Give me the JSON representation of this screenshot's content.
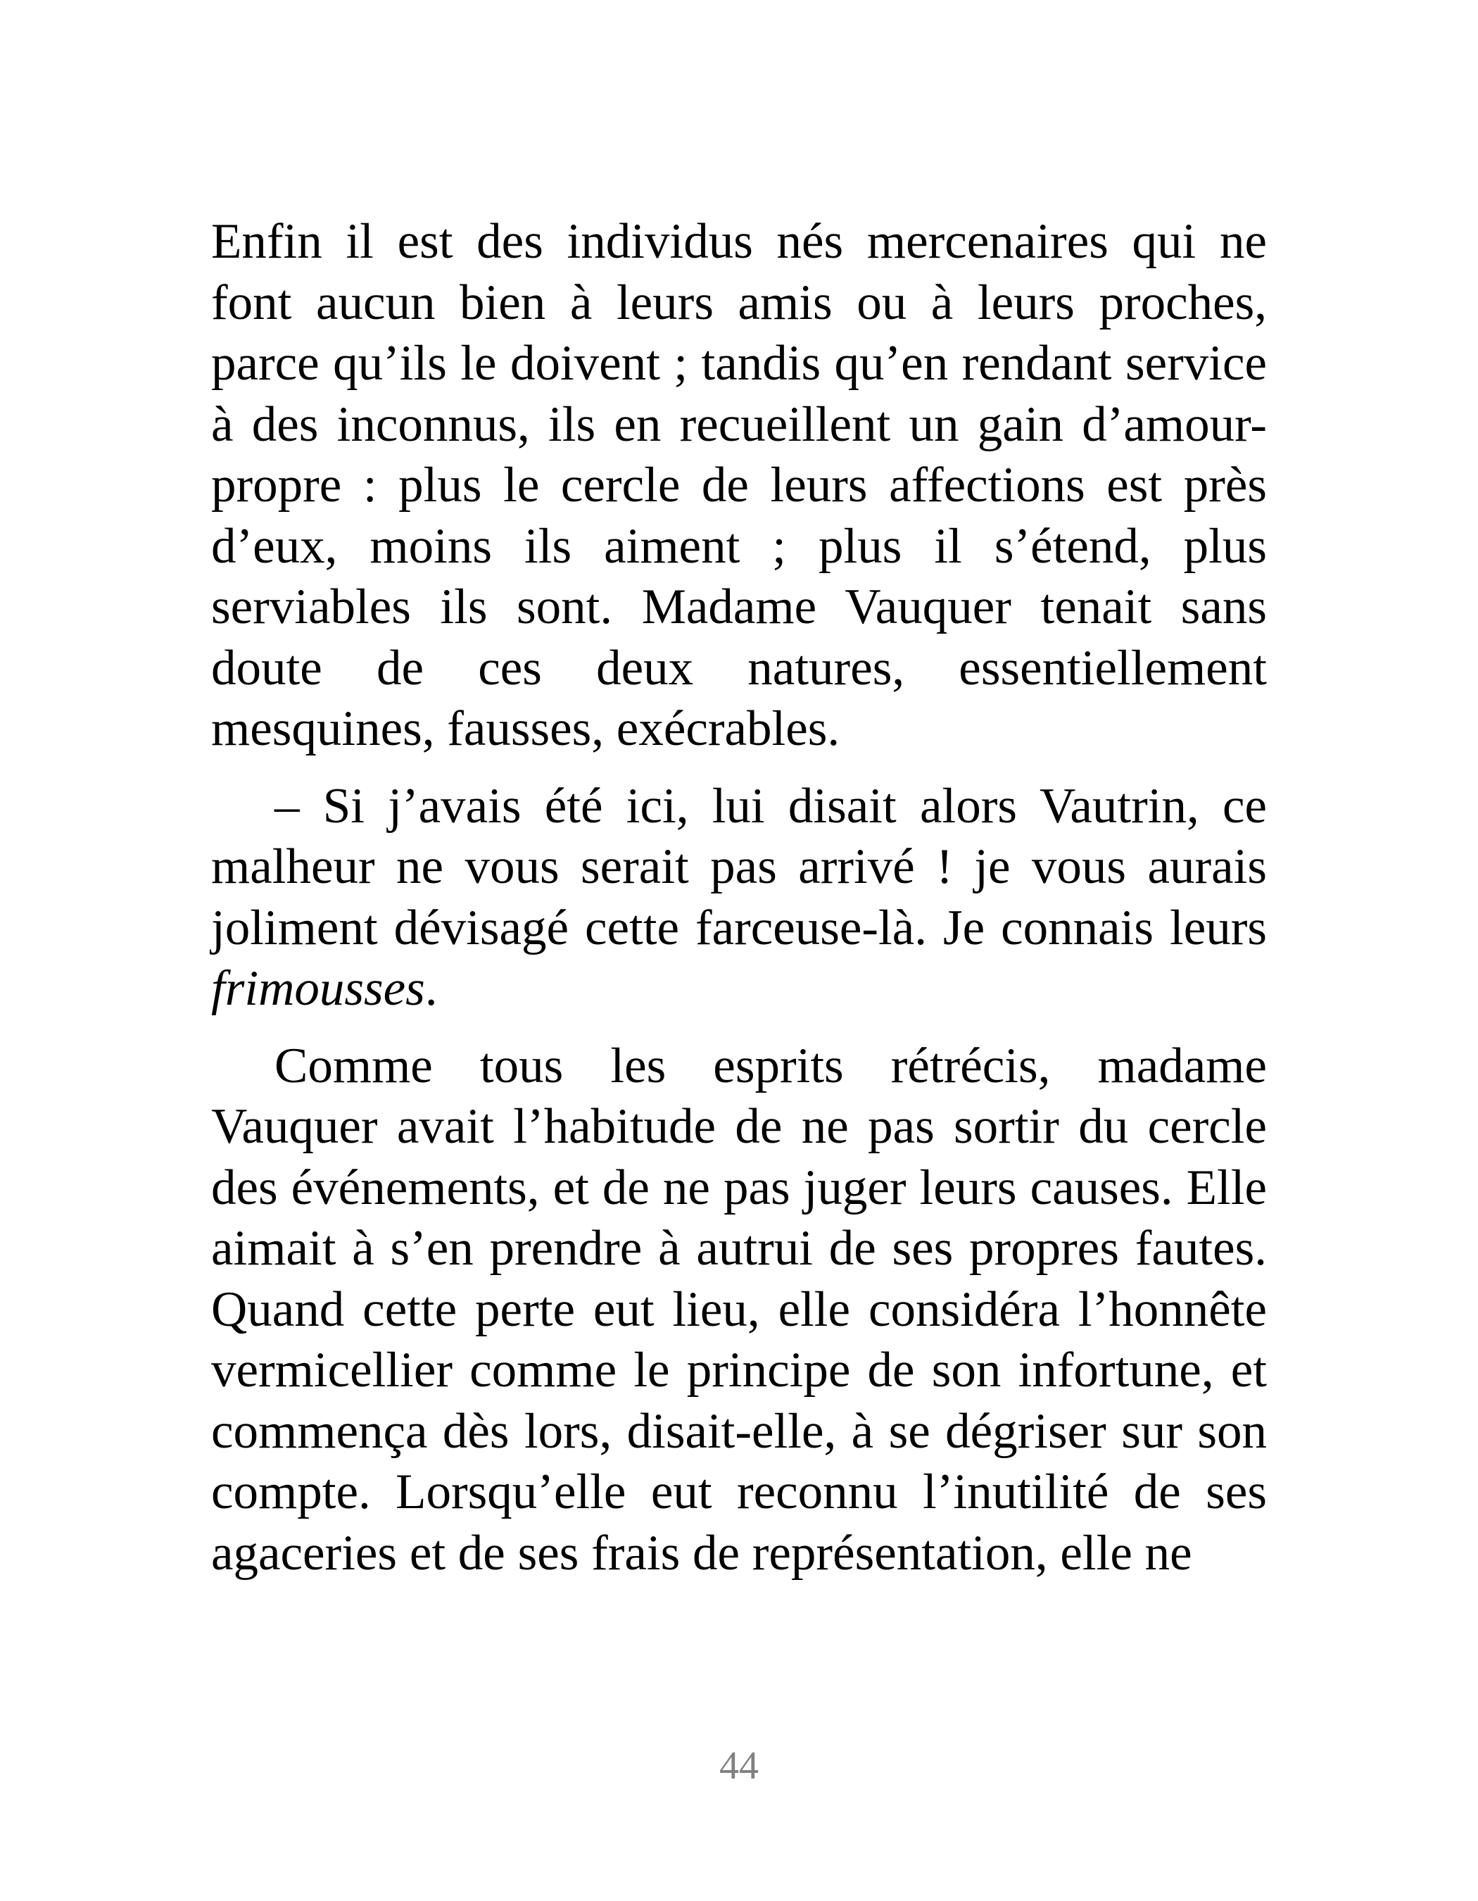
{
  "page": {
    "paragraphs": [
      {
        "parts": [
          {
            "text": "Enfin il est des individus nés mercenaires qui ne font aucun bien à leurs amis ou à leurs proches, parce qu’ils le doivent ; tandis qu’en rendant service à des inconnus, ils en recueillent un gain d’amour-propre : plus le cercle de leurs affections est près d’eux, moins ils aiment ; plus il s’étend, plus serviables ils sont. Madame Vauquer tenait sans doute de ces deux natures, essentiellement mesquines, fausses, exécrables."
          }
        ]
      },
      {
        "parts": [
          {
            "text": "– Si j’avais été ici, lui disait alors Vautrin, ce malheur ne vous serait pas arrivé ! je vous aurais joliment dévisagé cette farceuse-là. Je connais leurs "
          },
          {
            "text": "frimousses"
          },
          {
            "text": "."
          }
        ]
      },
      {
        "parts": [
          {
            "text": "Comme tous les esprits rétrécis, madame Vauquer avait l’habitude de ne pas sortir du cercle des événements, et de ne pas juger leurs causes. Elle aimait à s’en prendre à autrui de ses propres fautes. Quand cette perte eut lieu, elle considéra l’honnête vermicellier comme le principe de son infortune, et commença dès lors, disait-elle, à se dégriser sur son compte. Lorsqu’elle eut reconnu l’inutilité de ses agaceries et de ses frais de représentation, elle ne"
          }
        ]
      }
    ],
    "page_number": "44"
  }
}
